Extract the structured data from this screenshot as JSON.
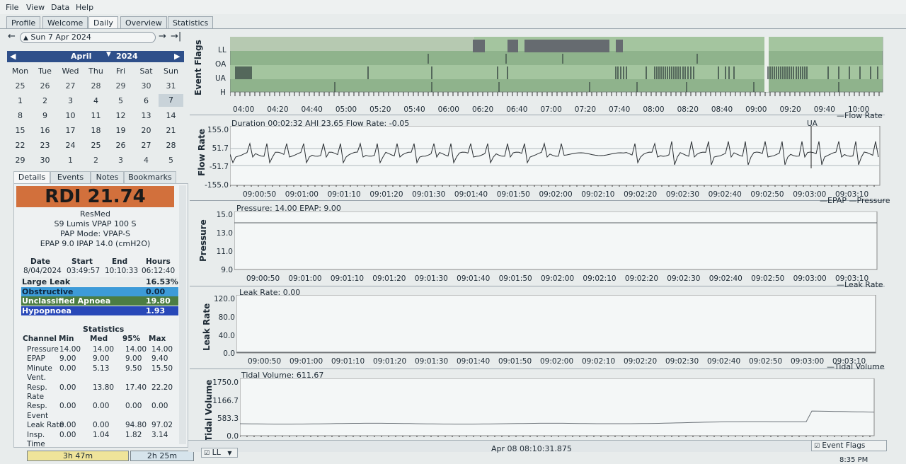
{
  "menu": [
    "File",
    "View",
    "Data",
    "Help"
  ],
  "tabs": [
    "Profile",
    "Welcome",
    "Daily",
    "Overview",
    "Statistics"
  ],
  "date_nav": {
    "current": "Sun 7 Apr 2024"
  },
  "calendar": {
    "month": "April",
    "year": "2024",
    "weekdays": [
      "Mon",
      "Tue",
      "Wed",
      "Thu",
      "Fri",
      "Sat",
      "Sun"
    ],
    "weeks": [
      [
        "25",
        "26",
        "27",
        "28",
        "29",
        "30",
        "31"
      ],
      [
        "1",
        "2",
        "3",
        "4",
        "5",
        "6",
        "7"
      ],
      [
        "8",
        "9",
        "10",
        "11",
        "12",
        "13",
        "14"
      ],
      [
        "15",
        "16",
        "17",
        "18",
        "19",
        "20",
        "21"
      ],
      [
        "22",
        "23",
        "24",
        "25",
        "26",
        "27",
        "28"
      ],
      [
        "29",
        "30",
        "1",
        "2",
        "3",
        "4",
        "5"
      ]
    ]
  },
  "detail_tabs": [
    "Details",
    "Events",
    "Notes",
    "Bookmarks"
  ],
  "rdi": "RDI 21.74",
  "device": {
    "brand": "ResMed",
    "model": "S9 Lumis VPAP 100 S",
    "mode": "PAP Mode: VPAP-S",
    "settings": "EPAP 9.0 IPAP 14.0 (cmH2O)"
  },
  "session": {
    "headers": [
      "Date",
      "Start",
      "End",
      "Hours"
    ],
    "values": [
      "8/04/2024",
      "03:49:57",
      "10:10:33",
      "06:12:40"
    ]
  },
  "summary": [
    {
      "label": "Large Leak",
      "value": "16.53%",
      "color": "#e8ecec",
      "text": "#1d2a35"
    },
    {
      "label": "Obstructive",
      "value": "0.00",
      "color": "#3d9bd8",
      "text": "#0e2740"
    },
    {
      "label": "Unclassified Apnoea",
      "value": "19.80",
      "color": "#4c7d43",
      "text": "#ffffff"
    },
    {
      "label": "Hypopnoea",
      "value": "1.93",
      "color": "#2848b8",
      "text": "#ffffff"
    }
  ],
  "stats": {
    "title": "Statistics",
    "headers": [
      "Channel",
      "Min",
      "Med",
      "95%",
      "Max"
    ],
    "rows": [
      [
        "Pressure",
        "14.00",
        "14.00",
        "14.00",
        "14.00"
      ],
      [
        "EPAP",
        "9.00",
        "9.00",
        "9.00",
        "9.40"
      ],
      [
        "Minute",
        "0.00",
        "5.13",
        "9.50",
        "15.50"
      ],
      [
        "Vent.",
        "",
        "",
        "",
        ""
      ],
      [
        "Resp.",
        "0.00",
        "13.80",
        "17.40",
        "22.20"
      ],
      [
        "Rate",
        "",
        "",
        "",
        ""
      ],
      [
        "Resp.",
        "0.00",
        "0.00",
        "0.00",
        "0.00"
      ],
      [
        "Event",
        "",
        "",
        "",
        ""
      ],
      [
        "Leak Rate",
        "0.00",
        "0.00",
        "94.80",
        "97.02"
      ],
      [
        "Insp.",
        "0.00",
        "1.04",
        "1.82",
        "3.14"
      ],
      [
        "Time",
        "",
        "",
        "",
        ""
      ]
    ]
  },
  "bottom_buttons": [
    "3h 47m",
    "2h 25m"
  ],
  "flags_panel": {
    "ylabel": "Event Flags",
    "rows": [
      "LL",
      "OA",
      "UA",
      "H"
    ],
    "xticks": [
      "04:00",
      "04:20",
      "04:40",
      "05:00",
      "05:20",
      "05:40",
      "06:00",
      "06:20",
      "06:40",
      "07:00",
      "07:20",
      "07:40",
      "08:00",
      "08:20",
      "08:40",
      "09:00",
      "09:20",
      "09:40",
      "10:00"
    ]
  },
  "flow_panel": {
    "ylabel": "Flow Rate",
    "legend": "Flow Rate",
    "info": "Duration 00:02:32 AHI 23.65 Flow Rate: -0.05",
    "yticks": [
      "155.0",
      "51.7",
      "-51.7",
      "-155.0"
    ],
    "annotation": "UA"
  },
  "pressure_panel": {
    "ylabel": "Pressure",
    "legend": "EPAP —Pressure",
    "info": "Pressure: 14.00 EPAP: 9.00",
    "yticks": [
      "15.0",
      "13.0",
      "11.0",
      "9.0"
    ]
  },
  "leak_panel": {
    "ylabel": "Leak Rate",
    "legend": "Leak Rate",
    "info": "Leak Rate: 0.00",
    "yticks": [
      "120.0",
      "80.0",
      "40.0",
      "0.0"
    ]
  },
  "tidal_panel": {
    "ylabel": "Tidal Volume",
    "legend": "Tidal Volume",
    "info": "Tidal Volume: 611.67",
    "yticks": [
      "1750.0",
      "1166.7",
      "583.3",
      "0.0"
    ]
  },
  "time_ticks": [
    "09:00:50",
    "09:01:00",
    "09:01:10",
    "09:01:20",
    "09:01:30",
    "09:01:40",
    "09:01:50",
    "09:02:00",
    "09:02:10",
    "09:02:20",
    "09:02:30",
    "09:02:40",
    "09:02:50",
    "09:03:00",
    "09:03:10"
  ],
  "status": {
    "dropdown": "LL",
    "timestamp": "Apr 08 08:10:31.875",
    "event_flags": "Event Flags",
    "clock": "8:35 PM"
  }
}
